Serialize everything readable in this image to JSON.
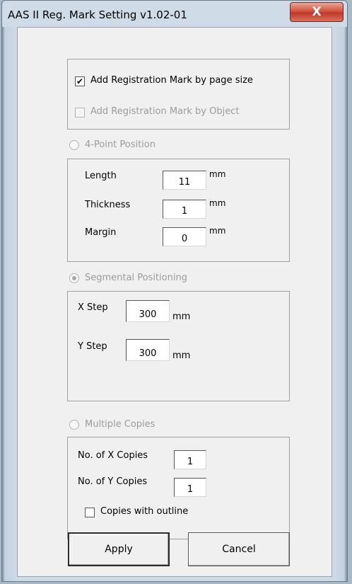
{
  "window": {
    "title": "AAS II Reg. Mark Setting v1.02-01",
    "close_glyph": "X"
  },
  "registration": {
    "page_size_label": "Add Registration Mark by page size",
    "page_size_checked": true,
    "object_label": "Add Registration Mark by Object",
    "object_checked": false
  },
  "four_point": {
    "label": "4-Point Position",
    "selected": false,
    "length_label": "Length",
    "length_value": "11",
    "length_unit": "mm",
    "thickness_label": "Thickness",
    "thickness_value": "1",
    "thickness_unit": "mm",
    "margin_label": "Margin",
    "margin_value": "0",
    "margin_unit": "mm"
  },
  "segmental": {
    "label": "Segmental Positioning",
    "selected": true,
    "x_step_label": "X Step",
    "x_step_value": "300",
    "x_step_unit": "mm",
    "y_step_label": "Y Step",
    "y_step_value": "300",
    "y_step_unit": "mm"
  },
  "multiple": {
    "label": "Multiple Copies",
    "selected": false,
    "x_copies_label": "No. of X Copies",
    "x_copies_value": "1",
    "y_copies_label": "No. of Y Copies",
    "y_copies_value": "1",
    "outline_label": "Copies with outline",
    "outline_checked": false
  },
  "buttons": {
    "apply": "Apply",
    "cancel": "Cancel"
  },
  "colors": {
    "frame": "#cfdbe7",
    "client": "#f0f0f0",
    "close_button": "#c0392b",
    "disabled_text": "#9c9c9c"
  }
}
